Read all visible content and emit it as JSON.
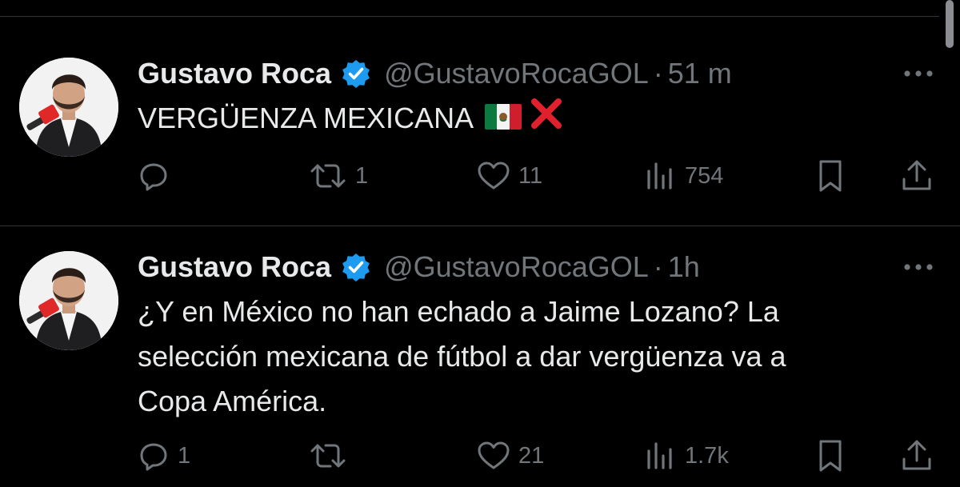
{
  "colors": {
    "background": "#000000",
    "text": "#e7e9ea",
    "muted": "#71767b",
    "verified": "#1d9bf0",
    "divider": "#2f3336"
  },
  "tweets": [
    {
      "author_name": "Gustavo Roca",
      "handle": "@GustavoRocaGOL",
      "separator": "·",
      "time": "51 m",
      "text": "VERGÜENZA MEXICANA",
      "emojis": [
        "mexico-flag-icon",
        "red-x-icon"
      ],
      "replies": "",
      "retweets": "1",
      "likes": "11",
      "views": "754"
    },
    {
      "author_name": "Gustavo Roca",
      "handle": "@GustavoRocaGOL",
      "separator": "·",
      "time": "1h",
      "text": "¿Y en México no han echado a Jaime Lozano? La\nselección mexicana de fútbol a dar vergüenza va a\nCopa América.",
      "replies": "1",
      "retweets": "",
      "likes": "21",
      "views": "1.7k"
    }
  ]
}
